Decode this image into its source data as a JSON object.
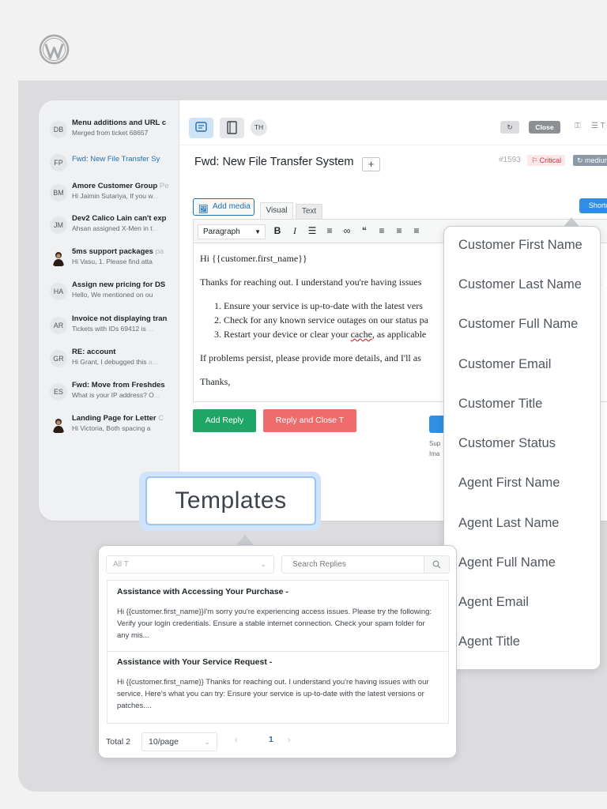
{
  "sidebar": {
    "tickets": [
      {
        "initials": "DB",
        "title": "Menu additions and URL c",
        "title_fade": "",
        "preview": "Merged from ticket 68657",
        "preview_fade": ""
      },
      {
        "initials": "FP",
        "title": "Fwd: New File Transfer Sy",
        "title_fade": "",
        "preview": "",
        "preview_fade": ""
      },
      {
        "initials": "BM",
        "title": "Amore Customer Group ",
        "title_fade": "Pе",
        "preview": "Hi Jaimin Sutariya, If you w",
        "preview_fade": "..."
      },
      {
        "initials": "JM",
        "title": "Dev2 Calico Lain can't exp",
        "title_fade": "",
        "preview": "Ahsan assigned X-Men in t",
        "preview_fade": "..."
      },
      {
        "initials": "",
        "title": "5ms support packages ",
        "title_fade": "pa",
        "preview": "Hi Vasu, 1. Please find atta",
        "preview_fade": ""
      },
      {
        "initials": "HA",
        "title": "Assign new pricing for DS",
        "title_fade": "",
        "preview": "Hello, We mentioned on ou",
        "preview_fade": ""
      },
      {
        "initials": "AR",
        "title": "Invoice not displaying tran",
        "title_fade": "",
        "preview": "Tickets with IDs 69412 is ",
        "preview_fade": "..."
      },
      {
        "initials": "GR",
        "title": "RE: account",
        "title_fade": "",
        "preview": "Hi Grant, I debugged this ",
        "preview_fade": "a..."
      },
      {
        "initials": "ES",
        "title": "Fwd: Move from Freshdes",
        "title_fade": "",
        "preview": "What is your IP address? O",
        "preview_fade": "..."
      },
      {
        "initials": "",
        "title": "Landing Page for Letter ",
        "title_fade": "C",
        "preview": "Hi Victoria, Both spacing a",
        "preview_fade": ""
      }
    ]
  },
  "toolbar": {
    "avatar_initials": "TH",
    "refresh_symbol": "↻",
    "close_label": "Close",
    "lock_symbol": "⚿",
    "more_symbol": "☰ T"
  },
  "ticket": {
    "subject": "Fwd: New File Transfer System",
    "plus_symbol": "+",
    "number": "#1593",
    "priority": "⚐ Critical",
    "status": "↻ medium"
  },
  "editor": {
    "add_media_label": "Add media",
    "tab_visual": "Visual",
    "tab_text": "Text",
    "shortcodes_label": "Shortcodes ˅",
    "format_select": "Paragraph",
    "toolbar_icons": [
      "B",
      "I",
      "☰",
      "≡",
      "∞",
      "“",
      "≡",
      "≡",
      "≡"
    ],
    "greeting": "Hi {{customer.first_name}}",
    "intro": "Thanks for reaching out. I understand you're having issues",
    "intro_tail": "t",
    "steps": [
      "Ensure your service is up-to-date with the latest vers",
      "Check for any known service outages on our status pa",
      "Restart your device or clear your "
    ],
    "step3_spell": "cache",
    "step3_tail": ", as applicable",
    "followup": "If problems persist, please provide more details, and I'll as",
    "signoff": "Thanks,"
  },
  "actions": {
    "add_reply_label": "Add Reply",
    "reply_close_label": "Reply and Close T",
    "small_line1": "Sup",
    "small_line2": "Ima",
    "side_letter": "N"
  },
  "shortcodes": {
    "items": [
      "Customer First Name",
      "Customer Last Name",
      "Customer Full Name",
      "Customer Email",
      "Customer Title",
      "Customer Status",
      "Agent First Name",
      "Agent Last Name",
      "Agent Full Name",
      "Agent Email",
      "Agent Title"
    ]
  },
  "templates": {
    "label": "Templates",
    "filter_value": "All T",
    "search_placeholder": "Search Replies",
    "items": [
      {
        "title": "Assistance with Accessing Your Purchase -",
        "desc": "Hi {{customer.first_name}}I'm sorry you're experiencing access issues. Please try the following: Verify your login credentials. Ensure a stable internet connection. Check your spam folder for any mis..."
      },
      {
        "title": "Assistance with Your Service Request -",
        "desc": "Hi {{customer.first_name}} Thanks for reaching out. I understand you're having issues with our service. Here's what you can try: Ensure your service is up-to-date with the latest versions or patches...."
      }
    ],
    "total": "Total 2",
    "page_size": "10/page",
    "current_page": "1"
  },
  "colors": {
    "accent": "#2271b1",
    "add_reply": "#1fa565",
    "reply_close": "#ee6c6c",
    "shortcodes_button": "#2f8fe5"
  }
}
